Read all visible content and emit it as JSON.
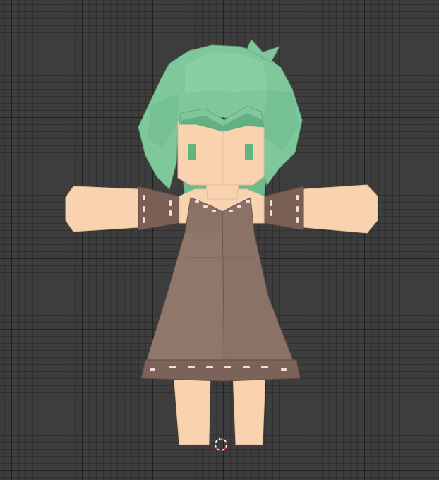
{
  "viewport": {
    "background_color": "#3d3d3d",
    "grid_major_color": "#262626",
    "grid_minor_color": "#333333",
    "x_axis_color": "#8a3a3a"
  },
  "model": {
    "hair_color": "#7fc89c",
    "skin_color": "#f9d3b0",
    "dress_color": "#8a7266",
    "sleeve_color": "#7a5f55",
    "stitch_color": "#f3ddd8",
    "eye_color": "#5fb77f"
  },
  "icons": {
    "3d_cursor": "3d-cursor-icon"
  }
}
